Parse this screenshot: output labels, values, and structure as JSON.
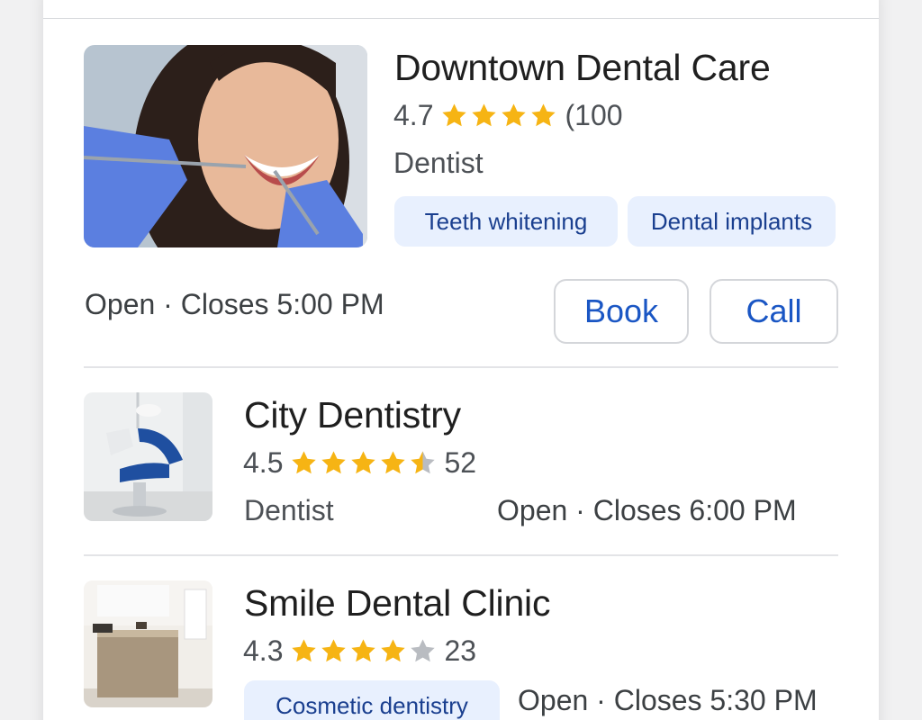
{
  "listings": [
    {
      "name": "Downtown Dental Care",
      "rating": "4.7",
      "reviews": "(100",
      "stars": [
        1,
        1,
        1,
        1
      ],
      "category": "Dentist",
      "chips": [
        "Teeth whitening",
        "Dental implants"
      ],
      "hours": "Open · Closes 5:00 PM",
      "actions": {
        "book_label": "Book",
        "call_label": "Call"
      }
    },
    {
      "name": "City Dentistry",
      "rating": "4.5",
      "reviews": "52",
      "stars": [
        1,
        1,
        1,
        1,
        0.5
      ],
      "category": "Dentist",
      "hours": "Open · Closes 6:00 PM"
    },
    {
      "name": "Smile Dental Clinic",
      "rating": "4.3",
      "reviews": "23",
      "stars": [
        1,
        1,
        1,
        1,
        0
      ],
      "chips": [
        "Cosmetic dentistry"
      ],
      "hours": "Open · Closes 5:30 PM"
    }
  ],
  "colors": {
    "star": "#f6b414",
    "star_empty": "#b9bcc1",
    "chip_bg": "#e8f0fe",
    "chip_text": "#1a3f8f",
    "action_text": "#1a56c4"
  }
}
